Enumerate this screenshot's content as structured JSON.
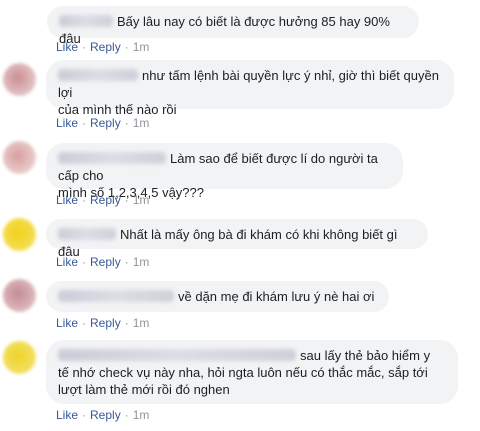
{
  "actions": {
    "like": "Like",
    "reply": "Reply",
    "dot": "·",
    "time": "1m"
  },
  "comments": [
    {
      "text": "Bấy lâu nay có biết là được hưởng 85 hay 90% đâu",
      "avatar_color": "#cfd5df"
    },
    {
      "text_line1": "như tấm lệnh bài quyền lực ý nhỉ, giờ thì biết quyền lợi",
      "text_line2": "của mình thế nào rồi",
      "avatar_color": "#d9a8a8"
    },
    {
      "text_line1": "Làm sao để biết được lí do người ta cấp cho",
      "text_line2": "mình số 1,2,3,4,5 vậy???",
      "avatar_color": "#e0b2b0"
    },
    {
      "text": "Nhất là mấy ông bà đi khám có khi không biết gì đâu",
      "avatar_color": "#f0d030"
    },
    {
      "text": "về dặn mẹ đi khám lưu ý nè hai ơi",
      "avatar_color": "#c99a9f"
    },
    {
      "text_line1": "sau lấy thẻ bảo hiểm y",
      "text_line2": "tế nhớ check vụ này nha, hỏi ngta luôn nếu có thắc mắc, sắp tới",
      "text_line3": "lượt làm thẻ mới rồi đó nghen",
      "avatar_color": "#e9d63a"
    }
  ]
}
